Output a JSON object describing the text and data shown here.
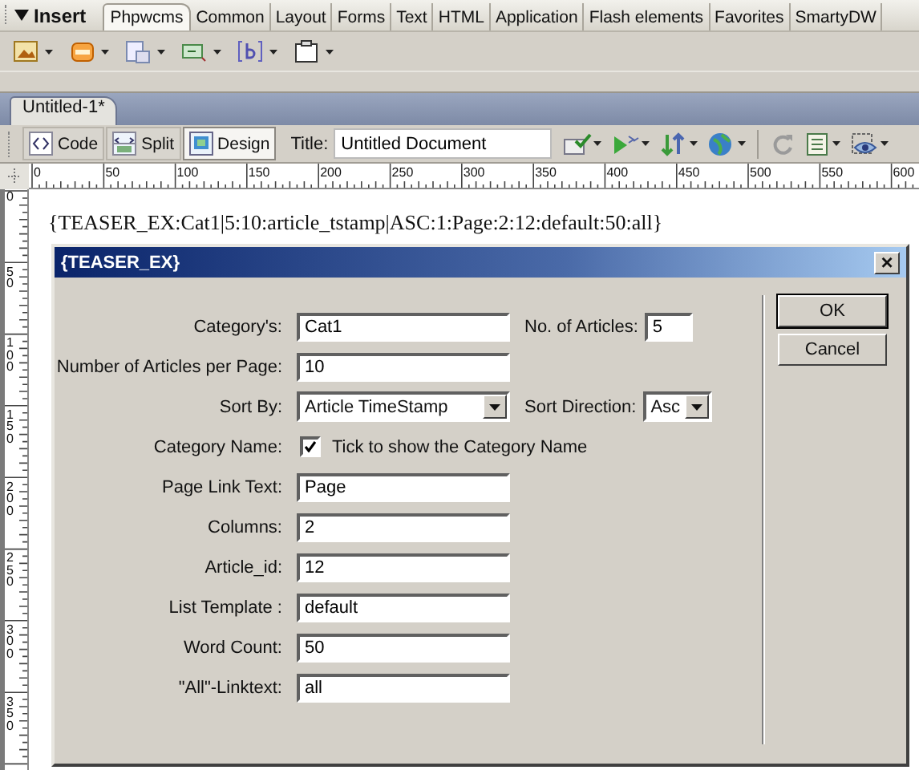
{
  "insert_bar": {
    "title": "Insert",
    "tabs": [
      {
        "label": "Phpwcms",
        "selected": true
      },
      {
        "label": "Common",
        "selected": false
      },
      {
        "label": "Layout",
        "selected": false
      },
      {
        "label": "Forms",
        "selected": false
      },
      {
        "label": "Text",
        "selected": false
      },
      {
        "label": "HTML",
        "selected": false
      },
      {
        "label": "Application",
        "selected": false
      },
      {
        "label": "Flash elements",
        "selected": false
      },
      {
        "label": "Favorites",
        "selected": false
      },
      {
        "label": "SmartyDW",
        "selected": false
      }
    ]
  },
  "document": {
    "tab": "Untitled-1*",
    "view_buttons": [
      {
        "label": "Code",
        "kind": "code",
        "selected": false
      },
      {
        "label": "Split",
        "kind": "split",
        "selected": false
      },
      {
        "label": "Design",
        "kind": "design",
        "selected": true
      }
    ],
    "title_label": "Title:",
    "title_value": "Untitled Document"
  },
  "ruler": {
    "horizontal_labels": [
      "0",
      "50",
      "100",
      "150",
      "200",
      "250",
      "300",
      "350",
      "400",
      "450",
      "500",
      "550",
      "600"
    ],
    "vertical_labels": [
      "0",
      "50",
      "100",
      "150",
      "200",
      "250",
      "300",
      "350"
    ]
  },
  "content_text": "{TEASER_EX:Cat1|5:10:article_tstamp|ASC:1:Page:2:12:default:50:all}",
  "dialog": {
    "title": "{TEASER_EX}",
    "close": "×",
    "rows": [
      {
        "fields": [
          {
            "kind": "text",
            "label": "Category's:",
            "value": "Cat1"
          },
          {
            "kind": "text",
            "label": "No. of Articles:",
            "value": "5"
          }
        ]
      },
      {
        "fields": [
          {
            "kind": "text",
            "label": "Number of Articles per Page:",
            "value": "10"
          }
        ]
      },
      {
        "fields": [
          {
            "kind": "select",
            "label": "Sort By:",
            "value": "Article TimeStamp"
          },
          {
            "kind": "select",
            "label": "Sort Direction:",
            "value": "Asc"
          }
        ]
      },
      {
        "fields": [
          {
            "kind": "checkbox",
            "label": "Category Name:",
            "checked": true,
            "caption": "Tick to show the Category Name"
          }
        ]
      },
      {
        "fields": [
          {
            "kind": "text",
            "label": "Page Link Text:",
            "value": "Page"
          }
        ]
      },
      {
        "fields": [
          {
            "kind": "text",
            "label": "Columns:",
            "value": "2"
          }
        ]
      },
      {
        "fields": [
          {
            "kind": "text",
            "label": "Article_id:",
            "value": "12"
          }
        ]
      },
      {
        "fields": [
          {
            "kind": "text",
            "label": "List Template :",
            "value": "default"
          }
        ]
      },
      {
        "fields": [
          {
            "kind": "text",
            "label": "Word Count:",
            "value": "50"
          }
        ]
      },
      {
        "fields": [
          {
            "kind": "text",
            "label": "\"All\"-Linktext:",
            "value": "all"
          }
        ]
      }
    ],
    "buttons": [
      {
        "label": "OK",
        "default": true
      },
      {
        "label": "Cancel",
        "default": false
      }
    ]
  }
}
